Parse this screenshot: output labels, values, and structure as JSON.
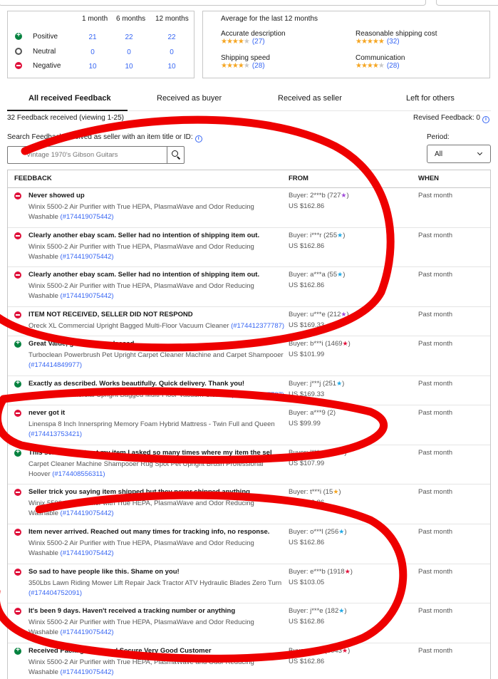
{
  "ratings": {
    "headers": [
      "1 month",
      "6 months",
      "12 months"
    ],
    "rows": [
      {
        "label": "Positive",
        "values": [
          "21",
          "22",
          "22"
        ],
        "kind": "positive"
      },
      {
        "label": "Neutral",
        "values": [
          "0",
          "0",
          "0"
        ],
        "kind": "neutral"
      },
      {
        "label": "Negative",
        "values": [
          "10",
          "10",
          "10"
        ],
        "kind": "negative"
      }
    ]
  },
  "detailed": {
    "title": "Average for the last 12 months",
    "items": [
      {
        "name": "Accurate description",
        "stars_filled": 4,
        "count": "(27)"
      },
      {
        "name": "Reasonable shipping cost",
        "stars_filled": 5,
        "count": "(32)"
      },
      {
        "name": "Shipping speed",
        "stars_filled": 4,
        "count": "(28)"
      },
      {
        "name": "Communication",
        "stars_filled": 4,
        "count": "(28)"
      }
    ]
  },
  "tabs": [
    {
      "label": "All received Feedback",
      "active": true
    },
    {
      "label": "Received as buyer",
      "active": false
    },
    {
      "label": "Received as seller",
      "active": false
    },
    {
      "label": "Left for others",
      "active": false
    }
  ],
  "summary": {
    "count_text": "32 Feedback received (viewing 1-25)",
    "revised_text": "Revised Feedback: 0"
  },
  "search": {
    "label": "Search Feedback received as seller with an item title or ID:",
    "placeholder": "Vintage 1970's Gibson Guitars"
  },
  "period": {
    "label": "Period:",
    "value": "All"
  },
  "table": {
    "headers": {
      "feedback": "FEEDBACK",
      "from": "FROM",
      "when": "WHEN"
    },
    "rows": [
      {
        "kind": "negative",
        "comment": "Never showed up",
        "item": "Winix 5500-2 Air Purifier with True HEPA, PlasmaWave and Odor Reducing Washable",
        "item_id": "(#174419075442)",
        "buyer": "Buyer: 2***b (727",
        "star_color": "#a14dd9",
        "price": "US $162.86",
        "when": "Past month"
      },
      {
        "kind": "negative",
        "comment": "Clearly another ebay scam. Seller had no intention of shipping item out.",
        "item": "Winix 5500-2 Air Purifier with True HEPA, PlasmaWave and Odor Reducing Washable",
        "item_id": "(#174419075442)",
        "buyer": "Buyer: i***r (255",
        "star_color": "#1fa9e6",
        "price": "US $162.86",
        "when": "Past month"
      },
      {
        "kind": "negative",
        "comment": "Clearly another ebay scam. Seller had no intention of shipping item out.",
        "item": "Winix 5500-2 Air Purifier with True HEPA, PlasmaWave and Odor Reducing Washable",
        "item_id": "(#174419075442)",
        "buyer": "Buyer: a***a (55",
        "star_color": "#1fa9e6",
        "price": "US $162.86",
        "when": "Past month"
      },
      {
        "kind": "negative",
        "comment": "ITEM NOT RECEIVED, SELLER DID NOT RESPOND",
        "item": "Oreck XL Commercial Upright Bagged Multi-Floor Vacuum Cleaner",
        "item_id": "(#174412377787)",
        "buyer": "Buyer: u***e (212",
        "star_color": "#a14dd9",
        "price": "US $169.33",
        "when": "Past month"
      },
      {
        "kind": "positive",
        "comment": "Great Value, good seller, pleased",
        "item": "Turboclean Powerbrush Pet Upright Carpet Cleaner Machine and Carpet Shampooer",
        "item_id": "(#174414849977)",
        "buyer": "Buyer: b***i (1469",
        "star_color": "#e0103a",
        "price": "US $101.99",
        "when": "Past month"
      },
      {
        "kind": "positive",
        "comment": "Exactly as described. Works beautifully. Quick delivery. Thank you!",
        "item": "Oreck XL Commercial Upright Bagged Multi-Floor Vacuum Cleaner",
        "item_id": "(#174412377787)",
        "buyer": "Buyer: j***j (251",
        "star_color": "#1fa9e6",
        "price": "US $169.33",
        "when": "Past month"
      },
      {
        "kind": "negative",
        "comment": "never got it",
        "item": "Linenspa 8 Inch Innerspring Memory Foam Hybrid Mattress - Twin Full and Queen",
        "item_id": "(#174413753421)",
        "buyer": "Buyer: a***9 (2)",
        "star_color": "",
        "price": "US $99.99",
        "when": "Past month"
      },
      {
        "kind": "positive",
        "comment": "This seller did not get my item I asked so many times where my item the sel",
        "item": "Carpet Cleaner Machine Shampooer Rug Spot Pet Upright Brush Professional Hoover",
        "item_id": "(#174408556311)",
        "buyer": "Buyer: l***n (676",
        "star_color": "#a14dd9",
        "price": "US $107.99",
        "when": "Past month"
      },
      {
        "kind": "negative",
        "comment": "Seller trick you saying item shipped but they never shipped anything",
        "item": "Winix 5500-2 Air Purifier with True HEPA, PlasmaWave and Odor Reducing Washable",
        "item_id": "(#174419075442)",
        "buyer": "Buyer: t***i (15",
        "star_color": "#f5a623",
        "price": "US $162.86",
        "when": "Past month"
      },
      {
        "kind": "negative",
        "comment": "Item never arrived. Reached out many times for tracking info, no response.",
        "item": "Winix 5500-2 Air Purifier with True HEPA, PlasmaWave and Odor Reducing Washable",
        "item_id": "(#174419075442)",
        "buyer": "Buyer: o***l (256",
        "star_color": "#1fa9e6",
        "price": "US $162.86",
        "when": "Past month"
      },
      {
        "kind": "negative",
        "comment": "So sad to have people like this. Shame on you!",
        "item": "350Lbs Lawn Riding Mower Lift Repair Jack Tractor ATV Hydraulic Blades Zero Turn",
        "item_id": "(#174404752091)",
        "buyer": "Buyer: e***b (1918",
        "star_color": "#e0103a",
        "price": "US $103.05",
        "when": "Past month"
      },
      {
        "kind": "negative",
        "comment": "It's been 9 days. Haven't received a tracking number or anything",
        "item": "Winix 5500-2 Air Purifier with True HEPA, PlasmaWave and Odor Reducing Washable",
        "item_id": "(#174419075442)",
        "buyer": "Buyer: j***e (182",
        "star_color": "#1fa9e6",
        "price": "US $162.86",
        "when": "Past month"
      },
      {
        "kind": "positive",
        "comment": "Received Package Nice and Secure Very Good Customer",
        "item": "Winix 5500-2 Air Purifier with True HEPA, PlasmaWave and Odor Reducing Washable",
        "item_id": "(#174419075442)",
        "buyer": "Buyer: i***y (3043",
        "star_color": "#e0103a",
        "price": "US $162.86",
        "when": "Past month"
      }
    ]
  },
  "colors": {
    "positive": "#05823f",
    "negative": "#e0103a",
    "link": "#3665f3",
    "annotation": "#ee0000"
  }
}
